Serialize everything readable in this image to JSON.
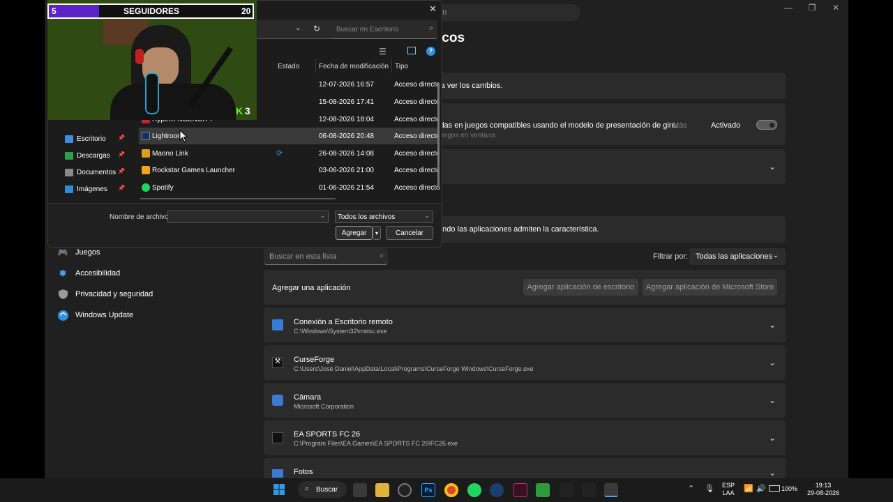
{
  "settings": {
    "search_placeholder": "on",
    "page_title": "icos",
    "restart_notice": "ra ver los cambios.",
    "flip_model_text": "idas en juegos compatibles usando el modelo de presentación de giro.",
    "flip_model_more": "Más",
    "windowed_games": "juegos en ventana",
    "toggle_label": "Activado",
    "pref_note": "ando las aplicaciones admiten la característica.",
    "nav": [
      {
        "label": "Juegos",
        "icon": "gamepad-icon"
      },
      {
        "label": "Accesibilidad",
        "icon": "accessibility-icon"
      },
      {
        "label": "Privacidad y seguridad",
        "icon": "shield-icon"
      },
      {
        "label": "Windows Update",
        "icon": "update-icon"
      }
    ],
    "list_search_placeholder": "Buscar en esta lista",
    "filter_label": "Filtrar por:",
    "filter_value": "Todas las aplicaciones",
    "add_app_label": "Agregar una aplicación",
    "add_desktop_btn": "Agregar aplicación de escritorio",
    "add_store_btn": "Agregar aplicación de Microsoft Store",
    "apps": [
      {
        "name": "Conexión a Escritorio remoto",
        "path": "C:\\Windows\\System32\\mstsc.exe",
        "icon": "remote-desktop-icon",
        "color": "#3a7bd5"
      },
      {
        "name": "CurseForge",
        "path": "C:\\Users\\José Daniel\\AppData\\Local\\Programs\\CurseForge Windows\\CurseForge.exe",
        "icon": "curseforge-icon",
        "color": "#111111"
      },
      {
        "name": "Cámara",
        "path": "Microsoft Corporation",
        "icon": "camera-icon",
        "color": "#3b7ad0"
      },
      {
        "name": "EA SPORTS FC 26",
        "path": "C:\\Program Files\\EA Games\\EA SPORTS FC 26\\FC26.exe",
        "icon": "fc26-icon",
        "color": "#111111"
      },
      {
        "name": "Fotos",
        "path": "",
        "icon": "photos-icon",
        "color": "#3b7ad0"
      }
    ]
  },
  "dialog": {
    "search_placeholder": "Buscar en Escritorio",
    "columns": {
      "status": "Estado",
      "modified": "Fecha de modificación",
      "type": "Tipo"
    },
    "quick_access": [
      {
        "label": "Escritorio",
        "color": "#3d8ee0"
      },
      {
        "label": "Descargas",
        "color": "#27a34b"
      },
      {
        "label": "Documentos",
        "color": "#8a8a8a"
      },
      {
        "label": "Imágenes",
        "color": "#2f8dd8"
      }
    ],
    "files": [
      {
        "name": "",
        "date": "12-07-2026 16:57",
        "type": "Acceso directo",
        "color": "#555"
      },
      {
        "name": "",
        "date": "15-08-2026 17:41",
        "type": "Acceso directo",
        "color": "#555"
      },
      {
        "name": "HyperX NGENUITY",
        "date": "12-08-2026 18:04",
        "type": "Acceso directo",
        "color": "#c0282d"
      },
      {
        "name": "Lightroom",
        "date": "06-08-2026 20:48",
        "type": "Acceso directo",
        "color": "#1b2f52"
      },
      {
        "name": "Maono Link",
        "date": "26-08-2026 14:08",
        "type": "Acceso directo",
        "color": "#d9a01b",
        "synced": true
      },
      {
        "name": "Rockstar Games Launcher",
        "date": "03-06-2026 21:00",
        "type": "Acceso directo",
        "color": "#f2a516"
      },
      {
        "name": "Spotify",
        "date": "01-06-2026 21:54",
        "type": "Acceso directo",
        "color": "#1ed760"
      }
    ],
    "filename_label": "Nombre de archivo:",
    "filename_value": "",
    "filetype_value": "Todos los archivos",
    "add_btn": "Agregar",
    "cancel_btn": "Cancelar"
  },
  "overlay": {
    "followers_current": "5",
    "followers_label": "SEGUIDORES",
    "followers_goal": "20",
    "kick_badge": "3"
  },
  "taskbar": {
    "search_label": "Buscar",
    "lang_top": "ESP",
    "lang_bottom": "LAA",
    "battery": "100%",
    "time": "19:13",
    "date": "29-08-2026"
  }
}
